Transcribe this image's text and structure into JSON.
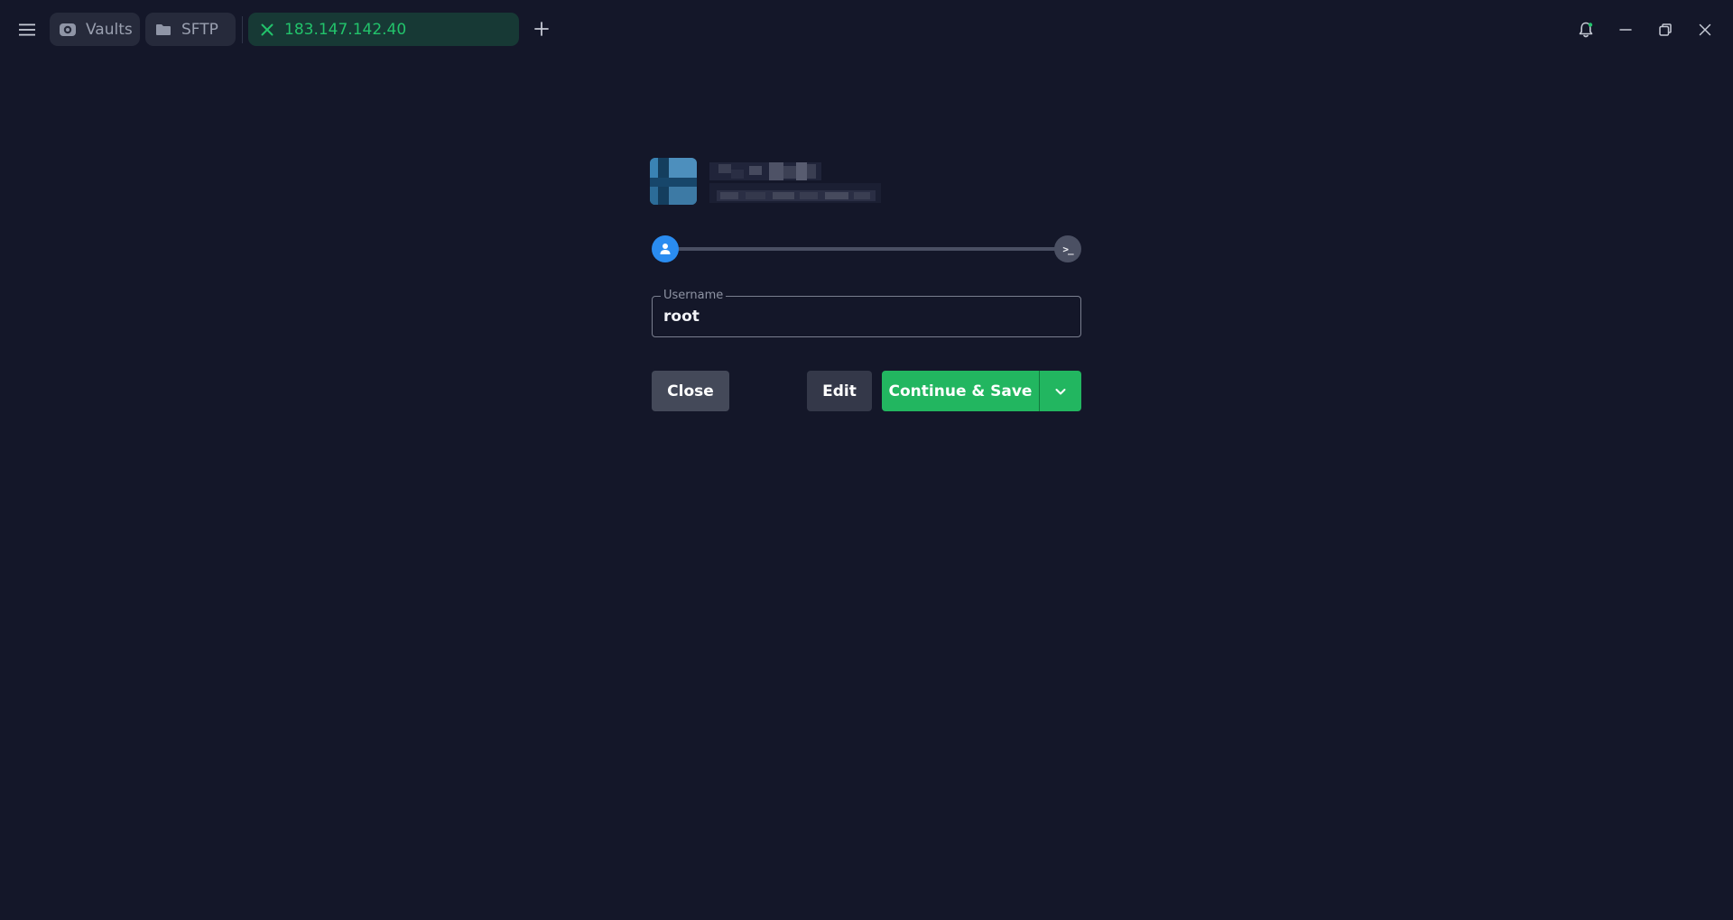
{
  "tabs": [
    {
      "label": "Vaults",
      "icon": "vault-icon"
    },
    {
      "label": "SFTP",
      "icon": "folder-icon"
    },
    {
      "label": "183.147.142.40",
      "icon": "close-icon",
      "active": true
    }
  ],
  "titlebar": {
    "menu_icon": "hamburger-menu-icon",
    "new_tab_icon": "plus-icon",
    "notifications_icon": "bell-icon",
    "minimize_icon": "minimize-icon",
    "restore_icon": "restore-icon",
    "close_icon": "close-icon"
  },
  "connection": {
    "host_avatar_icon": "host-avatar-icon",
    "progress": {
      "current_step": 1,
      "total_steps": 2,
      "fraction": 0.0,
      "steps": [
        {
          "icon": "user-icon",
          "state": "active"
        },
        {
          "icon": "terminal-icon",
          "label": ">_",
          "state": "pending"
        }
      ]
    },
    "username": {
      "label": "Username",
      "value": "root"
    },
    "buttons": {
      "close": "Close",
      "edit": "Edit",
      "continue_save": "Continue & Save",
      "more_icon": "chevron-down-icon"
    }
  },
  "colors": {
    "background": "#141729",
    "accent_green": "#22b660",
    "active_tab_bg": "#173935",
    "active_tab_text": "#22c36b",
    "step_active": "#2a8cf0",
    "step_pending": "#4b5063"
  }
}
